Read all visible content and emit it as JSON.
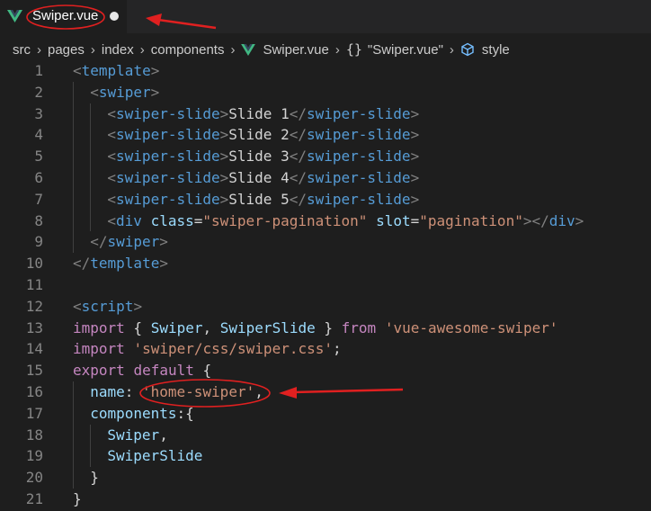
{
  "tab": {
    "title": "Swiper.vue"
  },
  "breadcrumb": {
    "items": [
      "src",
      "pages",
      "index",
      "components"
    ],
    "file": "Swiper.vue",
    "braces": "{}",
    "component": "\"Swiper.vue\"",
    "section": "style"
  },
  "colors": {
    "background": "#1e1e1e",
    "tag": "#569cd6",
    "attribute": "#9cdcfe",
    "string": "#ce9178",
    "keyword": "#c586c0",
    "vue_green": "#41b883",
    "annotation_red": "#e02020"
  },
  "editor": {
    "lines": [
      {
        "n": "1",
        "indent": 0,
        "tokens": [
          [
            "br",
            "<"
          ],
          [
            "tag",
            "template"
          ],
          [
            "br",
            ">"
          ]
        ]
      },
      {
        "n": "2",
        "indent": 1,
        "tokens": [
          [
            "br",
            "<"
          ],
          [
            "tag",
            "swiper"
          ],
          [
            "br",
            ">"
          ]
        ]
      },
      {
        "n": "3",
        "indent": 2,
        "tokens": [
          [
            "br",
            "<"
          ],
          [
            "tag",
            "swiper-slide"
          ],
          [
            "br",
            ">"
          ],
          [
            "txt",
            "Slide 1"
          ],
          [
            "br",
            "</"
          ],
          [
            "tag",
            "swiper-slide"
          ],
          [
            "br",
            ">"
          ]
        ]
      },
      {
        "n": "4",
        "indent": 2,
        "tokens": [
          [
            "br",
            "<"
          ],
          [
            "tag",
            "swiper-slide"
          ],
          [
            "br",
            ">"
          ],
          [
            "txt",
            "Slide 2"
          ],
          [
            "br",
            "</"
          ],
          [
            "tag",
            "swiper-slide"
          ],
          [
            "br",
            ">"
          ]
        ]
      },
      {
        "n": "5",
        "indent": 2,
        "tokens": [
          [
            "br",
            "<"
          ],
          [
            "tag",
            "swiper-slide"
          ],
          [
            "br",
            ">"
          ],
          [
            "txt",
            "Slide 3"
          ],
          [
            "br",
            "</"
          ],
          [
            "tag",
            "swiper-slide"
          ],
          [
            "br",
            ">"
          ]
        ]
      },
      {
        "n": "6",
        "indent": 2,
        "tokens": [
          [
            "br",
            "<"
          ],
          [
            "tag",
            "swiper-slide"
          ],
          [
            "br",
            ">"
          ],
          [
            "txt",
            "Slide 4"
          ],
          [
            "br",
            "</"
          ],
          [
            "tag",
            "swiper-slide"
          ],
          [
            "br",
            ">"
          ]
        ]
      },
      {
        "n": "7",
        "indent": 2,
        "tokens": [
          [
            "br",
            "<"
          ],
          [
            "tag",
            "swiper-slide"
          ],
          [
            "br",
            ">"
          ],
          [
            "txt",
            "Slide 5"
          ],
          [
            "br",
            "</"
          ],
          [
            "tag",
            "swiper-slide"
          ],
          [
            "br",
            ">"
          ]
        ]
      },
      {
        "n": "8",
        "indent": 2,
        "tokens": [
          [
            "br",
            "<"
          ],
          [
            "tag",
            "div"
          ],
          [
            "txt",
            " "
          ],
          [
            "attr",
            "class"
          ],
          [
            "txt",
            "="
          ],
          [
            "str",
            "\"swiper-pagination\""
          ],
          [
            "txt",
            " "
          ],
          [
            "attr",
            "slot"
          ],
          [
            "txt",
            "="
          ],
          [
            "str",
            "\"pagination\""
          ],
          [
            "br",
            "></"
          ],
          [
            "tag",
            "div"
          ],
          [
            "br",
            ">"
          ]
        ]
      },
      {
        "n": "9",
        "indent": 1,
        "tokens": [
          [
            "br",
            "</"
          ],
          [
            "tag",
            "swiper"
          ],
          [
            "br",
            ">"
          ]
        ]
      },
      {
        "n": "10",
        "indent": 0,
        "tokens": [
          [
            "br",
            "</"
          ],
          [
            "tag",
            "template"
          ],
          [
            "br",
            ">"
          ]
        ]
      },
      {
        "n": "11",
        "indent": 0,
        "tokens": []
      },
      {
        "n": "12",
        "indent": 0,
        "tokens": [
          [
            "br",
            "<"
          ],
          [
            "tag",
            "script"
          ],
          [
            "br",
            ">"
          ]
        ]
      },
      {
        "n": "13",
        "indent": 0,
        "tokens": [
          [
            "kw",
            "import"
          ],
          [
            "txt",
            " { "
          ],
          [
            "var",
            "Swiper"
          ],
          [
            "txt",
            ", "
          ],
          [
            "var",
            "SwiperSlide"
          ],
          [
            "txt",
            " } "
          ],
          [
            "kw",
            "from"
          ],
          [
            "txt",
            " "
          ],
          [
            "str",
            "'vue-awesome-swiper'"
          ]
        ]
      },
      {
        "n": "14",
        "indent": 0,
        "tokens": [
          [
            "kw",
            "import"
          ],
          [
            "txt",
            " "
          ],
          [
            "str",
            "'swiper/css/swiper.css'"
          ],
          [
            "txt",
            ";"
          ]
        ]
      },
      {
        "n": "15",
        "indent": 0,
        "tokens": [
          [
            "kw",
            "export"
          ],
          [
            "txt",
            " "
          ],
          [
            "kw",
            "default"
          ],
          [
            "txt",
            " {"
          ]
        ]
      },
      {
        "n": "16",
        "indent": 1,
        "tokens": [
          [
            "var",
            "name"
          ],
          [
            "txt",
            ": "
          ],
          [
            "str",
            "'home-swiper'"
          ],
          [
            "txt",
            ","
          ]
        ]
      },
      {
        "n": "17",
        "indent": 1,
        "tokens": [
          [
            "var",
            "components"
          ],
          [
            "txt",
            ":{"
          ]
        ]
      },
      {
        "n": "18",
        "indent": 2,
        "tokens": [
          [
            "var",
            "Swiper"
          ],
          [
            "txt",
            ","
          ]
        ]
      },
      {
        "n": "19",
        "indent": 2,
        "tokens": [
          [
            "var",
            "SwiperSlide"
          ]
        ]
      },
      {
        "n": "20",
        "indent": 1,
        "tokens": [
          [
            "txt",
            "}"
          ]
        ]
      },
      {
        "n": "21",
        "indent": 0,
        "tokens": [
          [
            "txt",
            "}"
          ]
        ]
      }
    ]
  }
}
